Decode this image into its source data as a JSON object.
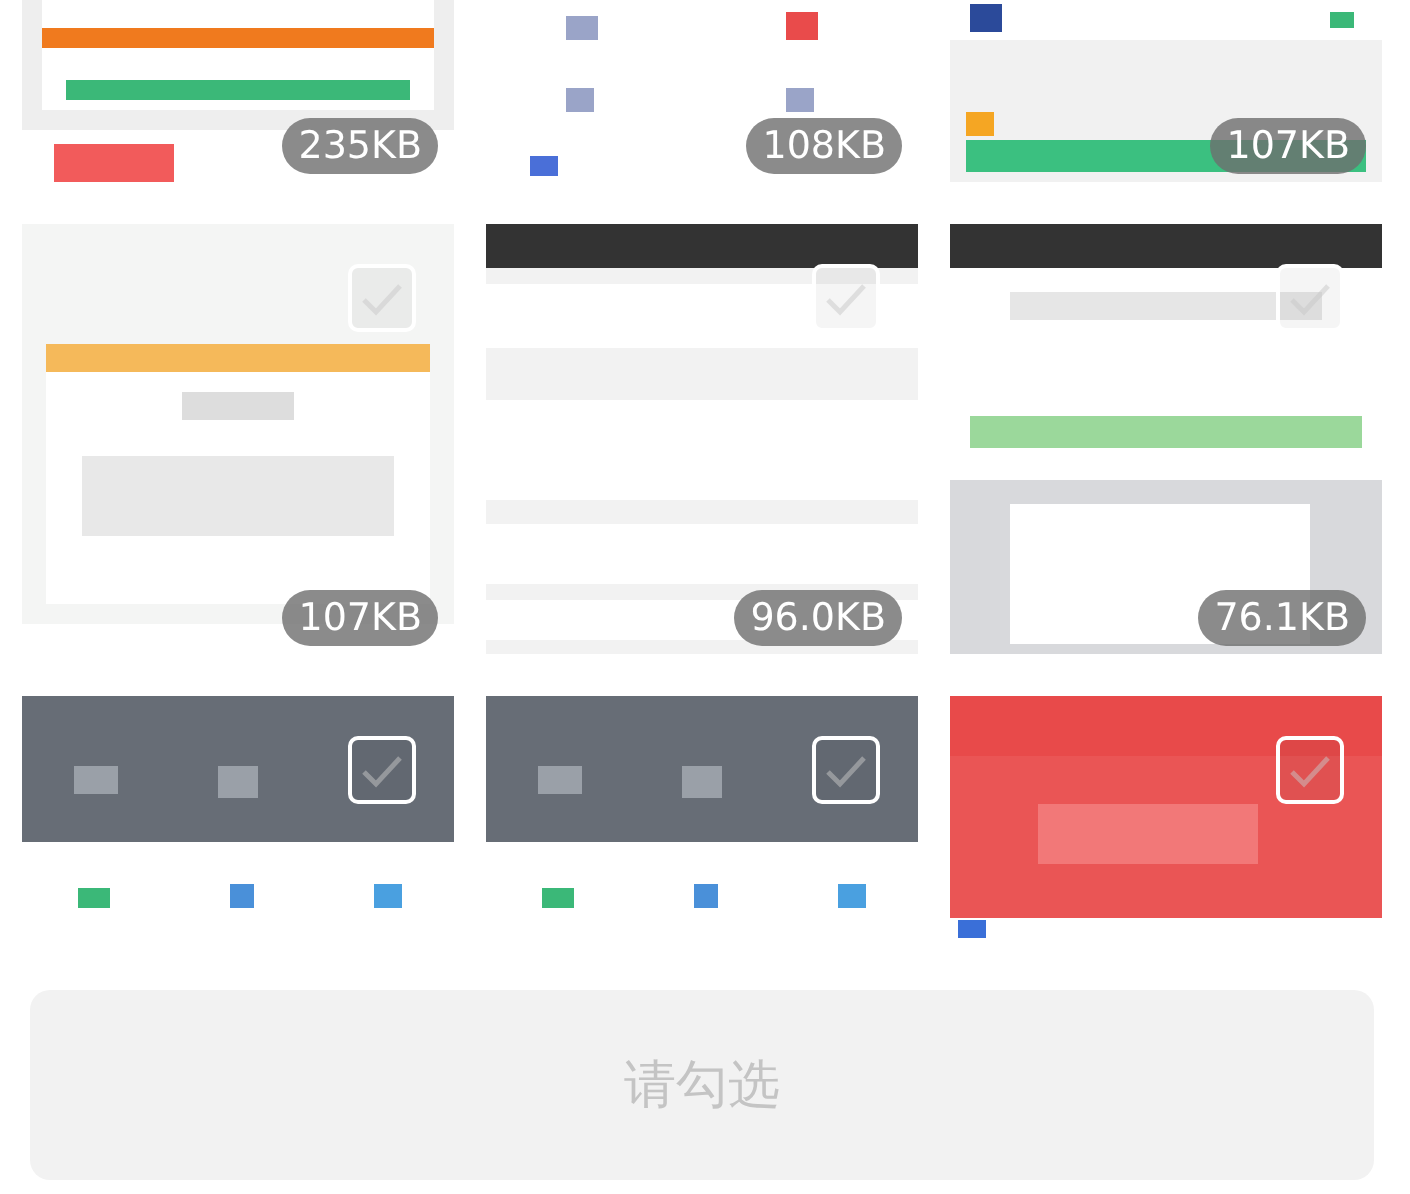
{
  "tiles": [
    {
      "size": "235KB"
    },
    {
      "size": "108KB"
    },
    {
      "size": "107KB"
    },
    {
      "size": "107KB",
      "checked": false
    },
    {
      "size": "96.0KB",
      "checked": false
    },
    {
      "size": "76.1KB",
      "checked": false
    },
    {
      "checked": false
    },
    {
      "checked": false
    },
    {
      "checked": false
    }
  ],
  "confirm_button": {
    "label": "请勾选",
    "disabled": true
  }
}
